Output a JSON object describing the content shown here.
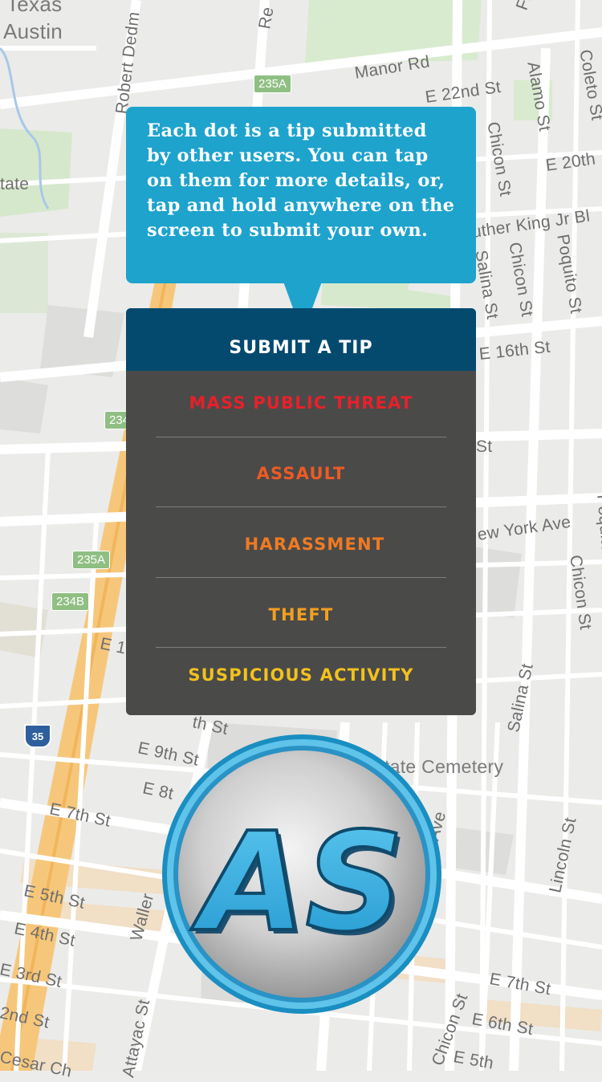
{
  "map": {
    "labels": {
      "texas": "Texas",
      "austin": "Austin",
      "state": "tate",
      "robert": "Robert Dedm",
      "re": "Re",
      "manor": "Manor Rd",
      "e22": "E 22nd St",
      "alamo": "Alamo St",
      "coleto": "Coleto St",
      "e20": "E 20th",
      "fr": "Fr",
      "chicon1": "Chicon St",
      "luther": "uther King Jr Bl",
      "chicon2": "Chicon St",
      "poquito1": "Poquito St",
      "salina1": "Salina St",
      "e16": "E 16th St",
      "st_frag": "St",
      "ny": "ew York Ave",
      "chicon3": "Chicon St",
      "poquito2": "Poquito",
      "salina2": "Salina St",
      "e9": "E 9th St",
      "e8": "E 8t",
      "th_st": "th St",
      "cemetery": "Texas State Cemetery",
      "e7": "E 7th St",
      "e5": "E 5th St",
      "e4": "E 4th St",
      "e3": "E 3rd St",
      "e2": "2nd St",
      "cesar": "Cesar Ch",
      "waller": "Waller",
      "attayac": "Attayac St",
      "lincoln": "Lincoln St",
      "e7b": "E 7th St",
      "e6": "E 6th St",
      "e5b": "E 5th",
      "chicon4": "Chicon St",
      "ave": "Ave",
      "e1": "E 1"
    },
    "shields": {
      "s235a_top": "235A",
      "s234": "234",
      "s235a": "235A",
      "s234b": "234B",
      "i35": "35"
    }
  },
  "tooltip": {
    "text": "Each dot is a tip submitted by other users. You can tap on them for more details, or, tap and hold anywhere on the screen to submit your own."
  },
  "panel": {
    "title": "SUBMIT A TIP",
    "items": [
      {
        "label": "MASS PUBLIC THREAT",
        "color": "#e8202a"
      },
      {
        "label": "ASSAULT",
        "color": "#ec5b24"
      },
      {
        "label": "HARASSMENT",
        "color": "#f07a22"
      },
      {
        "label": "THEFT",
        "color": "#f3a01f"
      },
      {
        "label": "SUSPICIOUS ACTIVITY",
        "color": "#f2c11e"
      }
    ]
  },
  "logo": {
    "text": "AS",
    "accent": "#35aee0"
  }
}
